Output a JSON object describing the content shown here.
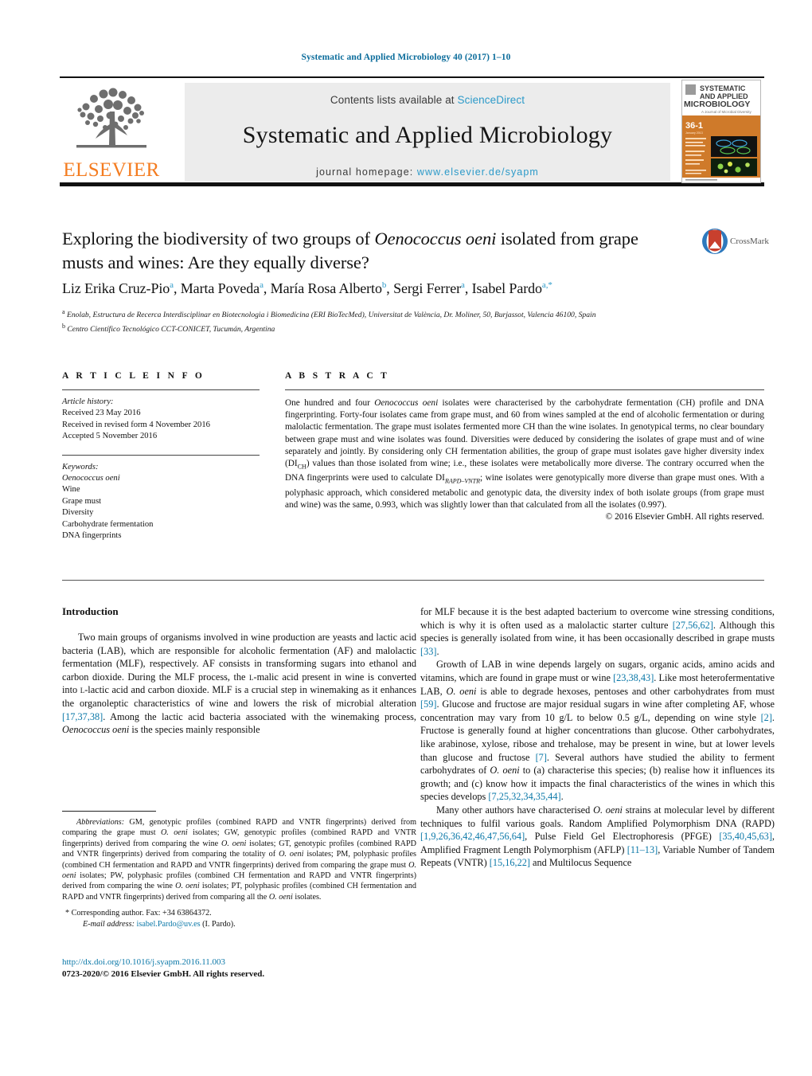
{
  "running_head": "Systematic and Applied Microbiology 40 (2017) 1–10",
  "masthead": {
    "contents_prefix": "Contents lists available at",
    "sciencedirect": "ScienceDirect",
    "journal_name": "Systematic and Applied Microbiology",
    "homepage_prefix": "journal homepage:",
    "homepage_url": "www.elsevier.de/syapm",
    "publisher_wordmark": "ELSEVIER",
    "cover": {
      "line1": "SYSTEMATIC",
      "line2": "AND APPLIED",
      "line3": "MICROBIOLOGY",
      "subtitle": "A Journal of Microbial Diversity",
      "volume": "36-1",
      "volume_sub": "January 2013"
    },
    "accent_orange": "#f47c20",
    "link_blue": "#2c9ac9"
  },
  "article": {
    "title_part1": "Exploring the biodiversity of two groups of ",
    "title_italic": "Oenococcus oeni",
    "title_part2": " isolated from grape musts and wines: Are they equally diverse?",
    "crossmark_label": "CrossMark",
    "authors": [
      {
        "name": "Liz Erika Cruz-Pio",
        "marks": "a"
      },
      {
        "name": "Marta Poveda",
        "marks": "a"
      },
      {
        "name": "María Rosa Alberto",
        "marks": "b"
      },
      {
        "name": "Sergi Ferrer",
        "marks": "a"
      },
      {
        "name": "Isabel Pardo",
        "marks": "a,*"
      }
    ],
    "affiliations": [
      {
        "mark": "a",
        "text": "Enolab, Estructura de Recerca Interdisciplinar en Biotecnologia i Biomedicina (ERI BioTecMed), Universitat de València, Dr. Moliner, 50, Burjassot, Valencia 46100, Spain"
      },
      {
        "mark": "b",
        "text": "Centro Científico Tecnológico CCT-CONICET, Tucumán, Argentina"
      }
    ]
  },
  "article_info": {
    "heading": "A R T I C L E   I N F O",
    "history_label": "Article history:",
    "history": [
      "Received 23 May 2016",
      "Received in revised form 4 November 2016",
      "Accepted 5 November 2016"
    ],
    "keywords_label": "Keywords:",
    "keywords": [
      "Oenococcus oeni",
      "Wine",
      "Grape must",
      "Diversity",
      "Carbohydrate fermentation",
      "DNA fingerprints"
    ]
  },
  "abstract": {
    "heading": "A B S T R A C T",
    "p1_a": "One hundred and four ",
    "p1_species": "Oenococcus oeni",
    "p1_b": " isolates were characterised by the carbohydrate fermentation (CH) profile and DNA fingerprinting. Forty-four isolates came from grape must, and 60 from wines sampled at the end of alcoholic fermentation or during malolactic fermentation. The grape must isolates fermented more CH than the wine isolates. In genotypical terms, no clear boundary between grape must and wine isolates was found. Diversities were deduced by considering the isolates of grape must and of wine separately and jointly. By considering only CH fermentation abilities, the group of grape must isolates gave higher diversity index (DI",
    "sub1": "CH",
    "p1_c": ") values than those isolated from wine; i.e., these isolates were metabolically more diverse. The contrary occurred when the DNA fingerprints were used to calculate DI",
    "sub2": "RAPD–VNTR",
    "p1_d": "; wine isolates were genotypically more diverse than grape must ones. With a polyphasic approach, which considered metabolic and genotypic data, the diversity index of both isolate groups (from grape must and wine) was the same, 0.993, which was slightly lower than that calculated from all the isolates (0.997).",
    "copyright": "© 2016 Elsevier GmbH. All rights reserved."
  },
  "body": {
    "intro_heading": "Introduction",
    "left_p1_a": "Two main groups of organisms involved in wine production are yeasts and lactic acid bacteria (LAB), which are responsible for alcoholic fermentation (AF) and malolactic fermentation (MLF), respectively. AF consists in transforming sugars into ethanol and carbon dioxide. During the MLF process, the ",
    "left_p1_sc1": "l",
    "left_p1_b": "-malic acid present in wine is converted into ",
    "left_p1_sc2": "l",
    "left_p1_c": "-lactic acid and carbon dioxide. MLF is a crucial step in winemaking as it enhances the organoleptic characteristics of wine and lowers the risk of microbial alteration ",
    "left_p1_ref": "[17,37,38]",
    "left_p1_d": ". Among the lactic acid bacteria associated with the winemaking process, ",
    "left_p1_species": "Oenococcus oeni",
    "left_p1_e": " is the species mainly responsible",
    "right_p1_a": "for MLF because it is the best adapted bacterium to overcome wine stressing conditions, which is why it is often used as a malolactic starter culture ",
    "right_p1_ref1": "[27,56,62]",
    "right_p1_b": ". Although this species is generally isolated from wine, it has been occasionally described in grape musts ",
    "right_p1_ref2": "[33]",
    "right_p1_c": ".",
    "right_p2_a": "Growth of LAB in wine depends largely on sugars, organic acids, amino acids and vitamins, which are found in grape must or wine ",
    "right_p2_ref1": "[23,38,43]",
    "right_p2_b": ". Like most heterofermentative LAB, ",
    "right_p2_sp1": "O. oeni",
    "right_p2_c": " is able to degrade hexoses, pentoses and other carbohydrates from must ",
    "right_p2_ref2": "[59]",
    "right_p2_d": ". Glucose and fructose are major residual sugars in wine after completing AF, whose concentration may vary from 10 g/L to below 0.5 g/L, depending on wine style ",
    "right_p2_ref3": "[2]",
    "right_p2_e": ". Fructose is generally found at higher concentrations than glucose. Other carbohydrates, like arabinose, xylose, ribose and trehalose, may be present in wine, but at lower levels than glucose and fructose ",
    "right_p2_ref4": "[7]",
    "right_p2_f": ". Several authors have studied the ability to ferment carbohydrates of ",
    "right_p2_sp2": "O. oeni",
    "right_p2_g": " to (a) characterise this species; (b) realise how it influences its growth; and (c) know how it impacts the final characteristics of the wines in which this species develops ",
    "right_p2_ref5": "[7,25,32,34,35,44]",
    "right_p2_h": ".",
    "right_p3_a": "Many other authors have characterised ",
    "right_p3_sp1": "O. oeni",
    "right_p3_b": " strains at molecular level by different techniques to fulfil various goals. Random Amplified Polymorphism DNA (RAPD) ",
    "right_p3_ref1": "[1,9,26,36,42,46,47,56,64]",
    "right_p3_c": ", Pulse Field Gel Electrophoresis (PFGE) ",
    "right_p3_ref2": "[35,40,45,63]",
    "right_p3_d": ", Amplified Fragment Length Polymorphism (AFLP) ",
    "right_p3_ref3": "[11–13]",
    "right_p3_e": ", Variable Number of Tandem Repeats (VNTR) ",
    "right_p3_ref4": "[15,16,22]",
    "right_p3_f": " and Multilocus Sequence"
  },
  "footnotes": {
    "abbrev_label": "Abbreviations:",
    "abbrev_a": " GM, genotypic profiles (combined RAPD and VNTR fingerprints) derived from comparing the grape must ",
    "abbrev_sp1": "O. oeni",
    "abbrev_b": " isolates; GW, genotypic profiles (combined RAPD and VNTR fingerprints) derived from comparing the wine ",
    "abbrev_sp2": "O. oeni",
    "abbrev_c": " isolates; GT, genotypic profiles (combined RAPD and VNTR fingerprints) derived from comparing the totality of ",
    "abbrev_sp3": "O. oeni",
    "abbrev_d": " isolates; PM, polyphasic profiles (combined CH fermentation and RAPD and VNTR fingerprints) derived from comparing the grape must ",
    "abbrev_sp4": "O. oeni",
    "abbrev_e": " isolates; PW, polyphasic profiles (combined CH fermentation and RAPD and VNTR fingerprints) derived from comparing the wine ",
    "abbrev_sp5": "O. oeni",
    "abbrev_f": " isolates; PT, polyphasic profiles (combined CH fermentation and RAPD and VNTR fingerprints) derived from comparing all the ",
    "abbrev_sp6": "O. oeni",
    "abbrev_g": " isolates.",
    "corresponding": "Corresponding author. Fax: +34 63864372.",
    "email_label": "E-mail address:",
    "email": "isabel.Pardo@uv.es",
    "email_suffix": " (I. Pardo)."
  },
  "doi": {
    "url": "http://dx.doi.org/10.1016/j.syapm.2016.11.003",
    "copyright": "0723-2020/© 2016 Elsevier GmbH. All rights reserved."
  }
}
